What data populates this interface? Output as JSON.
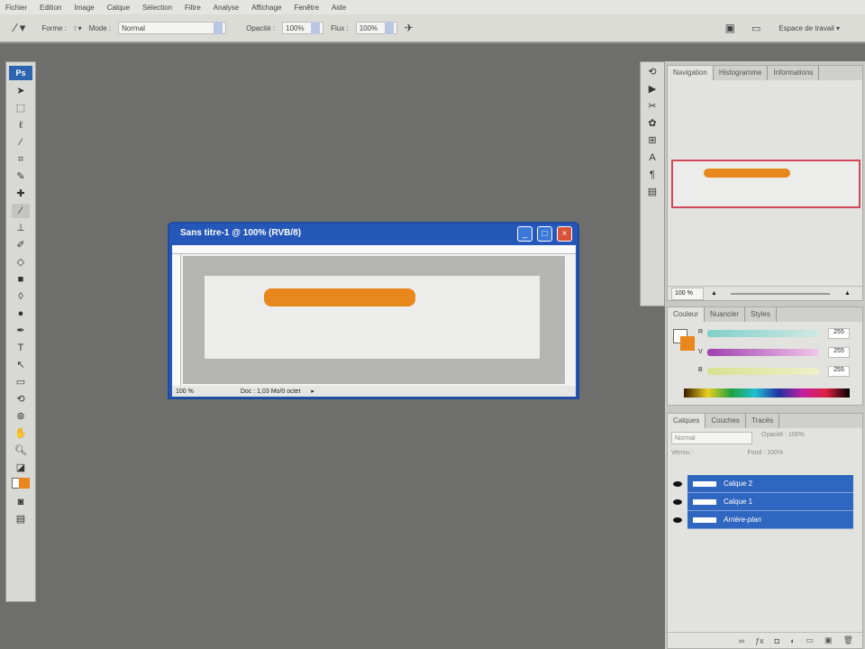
{
  "menu": [
    "Fichier",
    "Edition",
    "Image",
    "Calque",
    "Sélection",
    "Filtre",
    "Analyse",
    "Affichage",
    "Fenêtre",
    "Aide"
  ],
  "options": {
    "forme_label": "Forme :",
    "mode_label": "Mode :",
    "mode_value": "Normal",
    "opacity_label": "Opacité :",
    "opacity_value": "100%",
    "flux_label": "Flux :",
    "flux_value": "100%",
    "workspace": "Espace de travail ▾"
  },
  "toolbox": {
    "logo": "Ps"
  },
  "document": {
    "title": "Sans titre-1 @ 100% (RVB/8)",
    "zoom": "100 %",
    "status": "Doc : 1,03 Mo/0 octet",
    "accent": "#e8871c"
  },
  "navigator": {
    "tabs": [
      "Navigation",
      "Histogramme",
      "Informations"
    ],
    "zoom": "100 %"
  },
  "color": {
    "tabs": [
      "Couleur",
      "Nuancier",
      "Styles"
    ],
    "channels": [
      {
        "label": "R",
        "value": "255"
      },
      {
        "label": "V",
        "value": "255"
      },
      {
        "label": "B",
        "value": "255"
      }
    ]
  },
  "layers": {
    "tabs": [
      "Calques",
      "Couches",
      "Tracés"
    ],
    "blend": "Normal",
    "opacity": "Opacité : 100%",
    "lock": "Verrou :",
    "fill": "Fond : 100%",
    "items": [
      "Calque 2",
      "Calque 1",
      "Arrière-plan"
    ]
  }
}
